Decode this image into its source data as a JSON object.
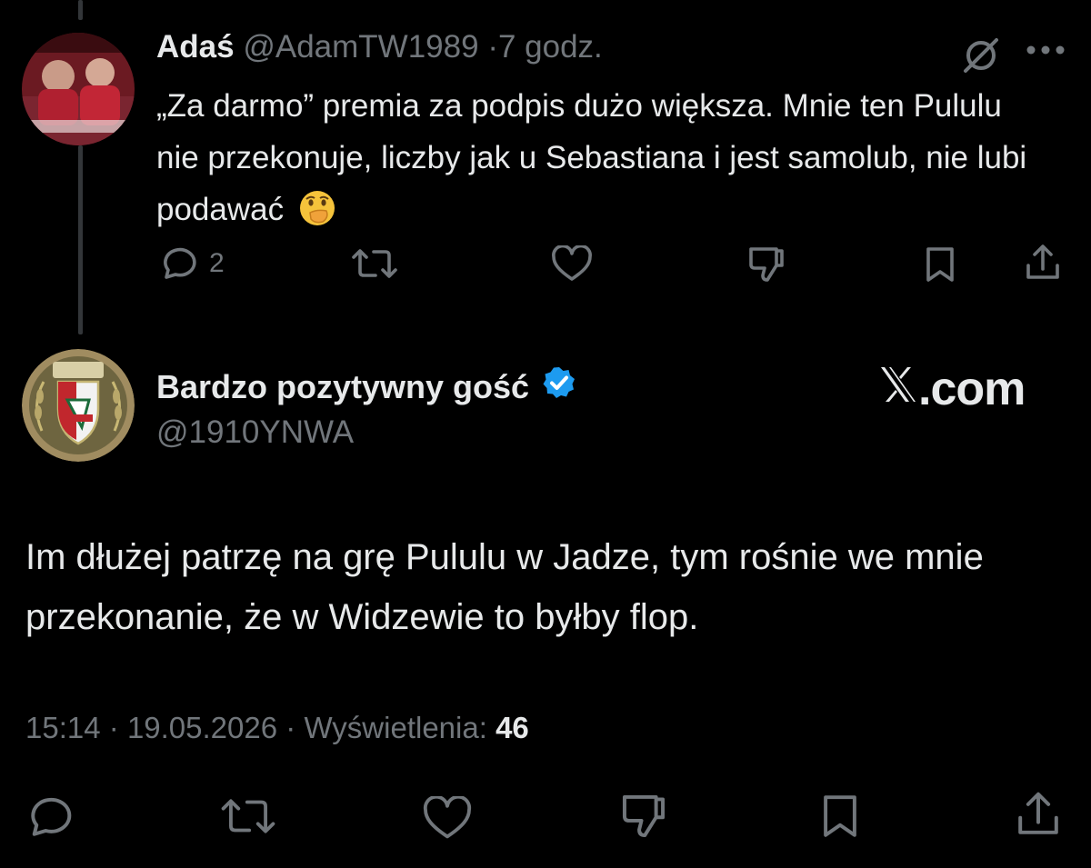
{
  "reply": {
    "display_name": "Adaś",
    "handle": "@AdamTW1989",
    "separator": "·",
    "time": "7 godz.",
    "text": "„Za darmo” premia za podpis dużo większa. Mnie ten Pululu nie przekonuje, liczby jak u Sebastiana i jest samolub, nie lubi podawać",
    "emoji": "face-with-hand-over-mouth-emoji",
    "reply_count": "2",
    "icons": [
      "grok-icon",
      "more-icon",
      "reply-icon",
      "retweet-icon",
      "like-icon",
      "dislike-icon",
      "bookmark-icon",
      "share-icon"
    ]
  },
  "main": {
    "display_name": "Bardzo pozytywny gość",
    "handle": "@1910YNWA",
    "brand": ".com",
    "text": "Im dłużej patrzę na grę Pululu w Jadze, tym rośnie we mnie przekonanie, że w Widzewie to byłby flop.",
    "time": "15:14",
    "separator": "·",
    "date": "19.05.2026",
    "views_label": "Wyświetlenia:",
    "views_count": "46",
    "icons": [
      "verified-badge-icon",
      "x-logo-icon",
      "reply-icon",
      "retweet-icon",
      "like-icon",
      "dislike-icon",
      "bookmark-icon",
      "share-icon"
    ]
  },
  "colors": {
    "background": "#000000",
    "text": "#e7e9ea",
    "muted": "#71767b",
    "verified": "#1d9bf0",
    "thread_line": "#333639"
  }
}
